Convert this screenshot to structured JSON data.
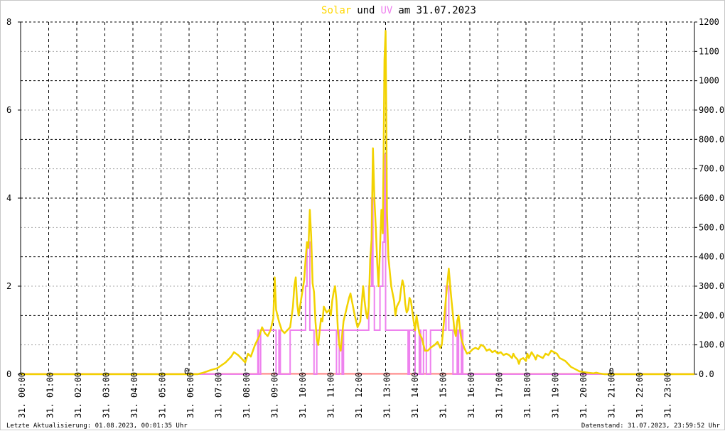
{
  "chart_data": {
    "type": "line",
    "title": {
      "part1": "Solar",
      "part2": "und",
      "part3": "UV",
      "part4": "am 31.07.2023"
    },
    "colors": {
      "solar": "#f2d200",
      "uv": "#ee82ee",
      "baseline": "#ff8080",
      "title_solar": "#ffd700",
      "title_uv": "#ee82ee",
      "title_text": "#000000"
    },
    "x_range": [
      0,
      24
    ],
    "y_left": {
      "range": [
        0,
        8
      ],
      "ticks": [
        "0",
        "2",
        "4",
        "6",
        "8"
      ]
    },
    "y_right": {
      "range": [
        0,
        1200
      ],
      "ticks": [
        "0.0",
        "100.0",
        "200.0",
        "300.0",
        "400.0",
        "500.0",
        "600.0",
        "700.0",
        "800.0",
        "900.0",
        "1000",
        "1100",
        "1200"
      ]
    },
    "x_ticks": [
      "31. 00:00",
      "31. 01:00",
      "31. 02:00",
      "31. 03:00",
      "31. 04:00",
      "31. 05:00",
      "31. 06:00",
      "31. 07:00",
      "31. 08:00",
      "31. 09:00",
      "31. 10:00",
      "31. 11:00",
      "31. 12:00",
      "31. 13:00",
      "31. 14:00",
      "31. 15:00",
      "31. 16:00",
      "31. 17:00",
      "31. 18:00",
      "31. 19:00",
      "31. 20:00",
      "31. 21:00",
      "31. 22:00",
      "31. 23:00"
    ],
    "grid": true,
    "series": [
      {
        "key": "solar",
        "axis": "right",
        "points": [
          [
            0,
            0
          ],
          [
            6.3,
            0
          ],
          [
            6.5,
            5
          ],
          [
            6.8,
            15
          ],
          [
            7.0,
            20
          ],
          [
            7.3,
            40
          ],
          [
            7.5,
            60
          ],
          [
            7.6,
            75
          ],
          [
            7.75,
            65
          ],
          [
            7.9,
            50
          ],
          [
            8.0,
            40
          ],
          [
            8.1,
            70
          ],
          [
            8.2,
            60
          ],
          [
            8.35,
            100
          ],
          [
            8.5,
            130
          ],
          [
            8.6,
            160
          ],
          [
            8.7,
            140
          ],
          [
            8.8,
            130
          ],
          [
            8.9,
            150
          ],
          [
            9.0,
            190
          ],
          [
            9.05,
            330
          ],
          [
            9.1,
            220
          ],
          [
            9.2,
            180
          ],
          [
            9.3,
            150
          ],
          [
            9.4,
            140
          ],
          [
            9.5,
            150
          ],
          [
            9.6,
            160
          ],
          [
            9.7,
            230
          ],
          [
            9.75,
            300
          ],
          [
            9.8,
            330
          ],
          [
            9.85,
            240
          ],
          [
            9.9,
            200
          ],
          [
            10.0,
            260
          ],
          [
            10.1,
            320
          ],
          [
            10.15,
            390
          ],
          [
            10.2,
            450
          ],
          [
            10.25,
            430
          ],
          [
            10.3,
            560
          ],
          [
            10.35,
            470
          ],
          [
            10.4,
            310
          ],
          [
            10.45,
            280
          ],
          [
            10.5,
            180
          ],
          [
            10.55,
            120
          ],
          [
            10.6,
            100
          ],
          [
            10.7,
            190
          ],
          [
            10.75,
            180
          ],
          [
            10.8,
            230
          ],
          [
            10.9,
            210
          ],
          [
            11.0,
            220
          ],
          [
            11.05,
            200
          ],
          [
            11.1,
            250
          ],
          [
            11.15,
            280
          ],
          [
            11.2,
            300
          ],
          [
            11.25,
            250
          ],
          [
            11.3,
            150
          ],
          [
            11.35,
            100
          ],
          [
            11.4,
            80
          ],
          [
            11.5,
            180
          ],
          [
            11.6,
            220
          ],
          [
            11.7,
            260
          ],
          [
            11.75,
            275
          ],
          [
            11.8,
            250
          ],
          [
            11.9,
            200
          ],
          [
            12.0,
            160
          ],
          [
            12.1,
            180
          ],
          [
            12.15,
            240
          ],
          [
            12.2,
            300
          ],
          [
            12.25,
            250
          ],
          [
            12.3,
            210
          ],
          [
            12.35,
            190
          ],
          [
            12.4,
            230
          ],
          [
            12.45,
            390
          ],
          [
            12.5,
            460
          ],
          [
            12.55,
            770
          ],
          [
            12.6,
            600
          ],
          [
            12.65,
            500
          ],
          [
            12.7,
            380
          ],
          [
            12.75,
            300
          ],
          [
            12.8,
            430
          ],
          [
            12.85,
            560
          ],
          [
            12.9,
            480
          ],
          [
            12.93,
            750
          ],
          [
            12.96,
            1070
          ],
          [
            13.0,
            1170
          ],
          [
            13.05,
            550
          ],
          [
            13.1,
            400
          ],
          [
            13.2,
            300
          ],
          [
            13.3,
            250
          ],
          [
            13.35,
            200
          ],
          [
            13.4,
            230
          ],
          [
            13.5,
            250
          ],
          [
            13.55,
            290
          ],
          [
            13.6,
            320
          ],
          [
            13.65,
            300
          ],
          [
            13.7,
            240
          ],
          [
            13.75,
            210
          ],
          [
            13.8,
            220
          ],
          [
            13.85,
            260
          ],
          [
            13.9,
            250
          ],
          [
            14.0,
            180
          ],
          [
            14.05,
            150
          ],
          [
            14.1,
            200
          ],
          [
            14.15,
            170
          ],
          [
            14.2,
            140
          ],
          [
            14.3,
            120
          ],
          [
            14.4,
            80
          ],
          [
            14.5,
            80
          ],
          [
            14.6,
            90
          ],
          [
            14.75,
            100
          ],
          [
            14.85,
            110
          ],
          [
            14.95,
            90
          ],
          [
            15.0,
            100
          ],
          [
            15.05,
            150
          ],
          [
            15.1,
            200
          ],
          [
            15.15,
            260
          ],
          [
            15.2,
            310
          ],
          [
            15.25,
            360
          ],
          [
            15.3,
            300
          ],
          [
            15.35,
            250
          ],
          [
            15.4,
            200
          ],
          [
            15.45,
            150
          ],
          [
            15.5,
            130
          ],
          [
            15.55,
            180
          ],
          [
            15.6,
            200
          ],
          [
            15.65,
            150
          ],
          [
            15.7,
            120
          ],
          [
            15.8,
            90
          ],
          [
            15.9,
            70
          ],
          [
            16.0,
            75
          ],
          [
            16.1,
            85
          ],
          [
            16.2,
            90
          ],
          [
            16.3,
            85
          ],
          [
            16.4,
            100
          ],
          [
            16.5,
            95
          ],
          [
            16.6,
            80
          ],
          [
            16.7,
            85
          ],
          [
            16.8,
            75
          ],
          [
            16.9,
            80
          ],
          [
            17.0,
            70
          ],
          [
            17.1,
            75
          ],
          [
            17.2,
            65
          ],
          [
            17.3,
            70
          ],
          [
            17.4,
            65
          ],
          [
            17.5,
            55
          ],
          [
            17.55,
            70
          ],
          [
            17.6,
            60
          ],
          [
            17.7,
            50
          ],
          [
            17.75,
            35
          ],
          [
            17.8,
            50
          ],
          [
            17.9,
            55
          ],
          [
            18.0,
            45
          ],
          [
            18.05,
            70
          ],
          [
            18.1,
            55
          ],
          [
            18.2,
            75
          ],
          [
            18.3,
            60
          ],
          [
            18.35,
            50
          ],
          [
            18.4,
            65
          ],
          [
            18.5,
            60
          ],
          [
            18.6,
            55
          ],
          [
            18.7,
            70
          ],
          [
            18.8,
            65
          ],
          [
            18.9,
            80
          ],
          [
            19.0,
            75
          ],
          [
            19.1,
            70
          ],
          [
            19.2,
            55
          ],
          [
            19.3,
            50
          ],
          [
            19.4,
            45
          ],
          [
            19.5,
            35
          ],
          [
            19.6,
            25
          ],
          [
            19.7,
            20
          ],
          [
            19.8,
            15
          ],
          [
            19.9,
            10
          ],
          [
            20.0,
            8
          ],
          [
            20.2,
            5
          ],
          [
            20.4,
            3
          ],
          [
            20.5,
            5
          ],
          [
            20.6,
            3
          ],
          [
            20.8,
            0
          ],
          [
            24,
            0
          ]
        ]
      },
      {
        "key": "uv",
        "axis": "left",
        "points": [
          [
            0,
            0
          ],
          [
            8.45,
            0
          ],
          [
            8.45,
            1
          ],
          [
            8.48,
            1
          ],
          [
            8.48,
            0
          ],
          [
            8.55,
            0
          ],
          [
            8.55,
            1
          ],
          [
            9.1,
            1
          ],
          [
            9.1,
            0
          ],
          [
            9.2,
            0
          ],
          [
            9.2,
            1
          ],
          [
            9.25,
            1
          ],
          [
            9.25,
            0
          ],
          [
            9.6,
            0
          ],
          [
            9.6,
            1
          ],
          [
            10.15,
            1
          ],
          [
            10.15,
            2
          ],
          [
            10.2,
            2
          ],
          [
            10.2,
            3
          ],
          [
            10.3,
            3
          ],
          [
            10.3,
            1
          ],
          [
            10.45,
            1
          ],
          [
            10.45,
            0
          ],
          [
            10.55,
            0
          ],
          [
            10.55,
            1
          ],
          [
            11.25,
            1
          ],
          [
            11.25,
            0
          ],
          [
            11.35,
            0
          ],
          [
            11.35,
            1
          ],
          [
            11.45,
            1
          ],
          [
            11.45,
            0
          ],
          [
            11.5,
            0
          ],
          [
            11.5,
            1
          ],
          [
            12.4,
            1
          ],
          [
            12.4,
            2
          ],
          [
            12.5,
            2
          ],
          [
            12.5,
            4
          ],
          [
            12.55,
            4
          ],
          [
            12.55,
            2
          ],
          [
            12.6,
            2
          ],
          [
            12.6,
            1
          ],
          [
            12.8,
            1
          ],
          [
            12.8,
            2
          ],
          [
            12.9,
            2
          ],
          [
            12.9,
            3
          ],
          [
            12.95,
            3
          ],
          [
            12.95,
            5
          ],
          [
            13.0,
            5
          ],
          [
            13.0,
            1
          ],
          [
            13.8,
            1
          ],
          [
            13.8,
            0
          ],
          [
            13.85,
            0
          ],
          [
            13.85,
            1
          ],
          [
            14.05,
            1
          ],
          [
            14.05,
            0
          ],
          [
            14.2,
            0
          ],
          [
            14.2,
            1
          ],
          [
            14.25,
            1
          ],
          [
            14.25,
            0
          ],
          [
            14.35,
            0
          ],
          [
            14.35,
            1
          ],
          [
            14.45,
            1
          ],
          [
            14.45,
            0
          ],
          [
            14.6,
            0
          ],
          [
            14.6,
            1
          ],
          [
            15.15,
            1
          ],
          [
            15.15,
            2
          ],
          [
            15.25,
            2
          ],
          [
            15.25,
            1
          ],
          [
            15.4,
            1
          ],
          [
            15.4,
            0
          ],
          [
            15.55,
            0
          ],
          [
            15.55,
            1
          ],
          [
            15.6,
            1
          ],
          [
            15.6,
            0
          ],
          [
            15.7,
            0
          ],
          [
            15.7,
            1
          ],
          [
            15.75,
            1
          ],
          [
            15.75,
            0
          ],
          [
            24,
            0
          ]
        ]
      }
    ],
    "markers": {
      "left": "0",
      "right": "0"
    },
    "footer": {
      "left": "Letzte Aktualisierung: 01.08.2023, 00:01:35 Uhr",
      "right": "Datenstand: 31.07.2023, 23:59:52 Uhr"
    }
  }
}
